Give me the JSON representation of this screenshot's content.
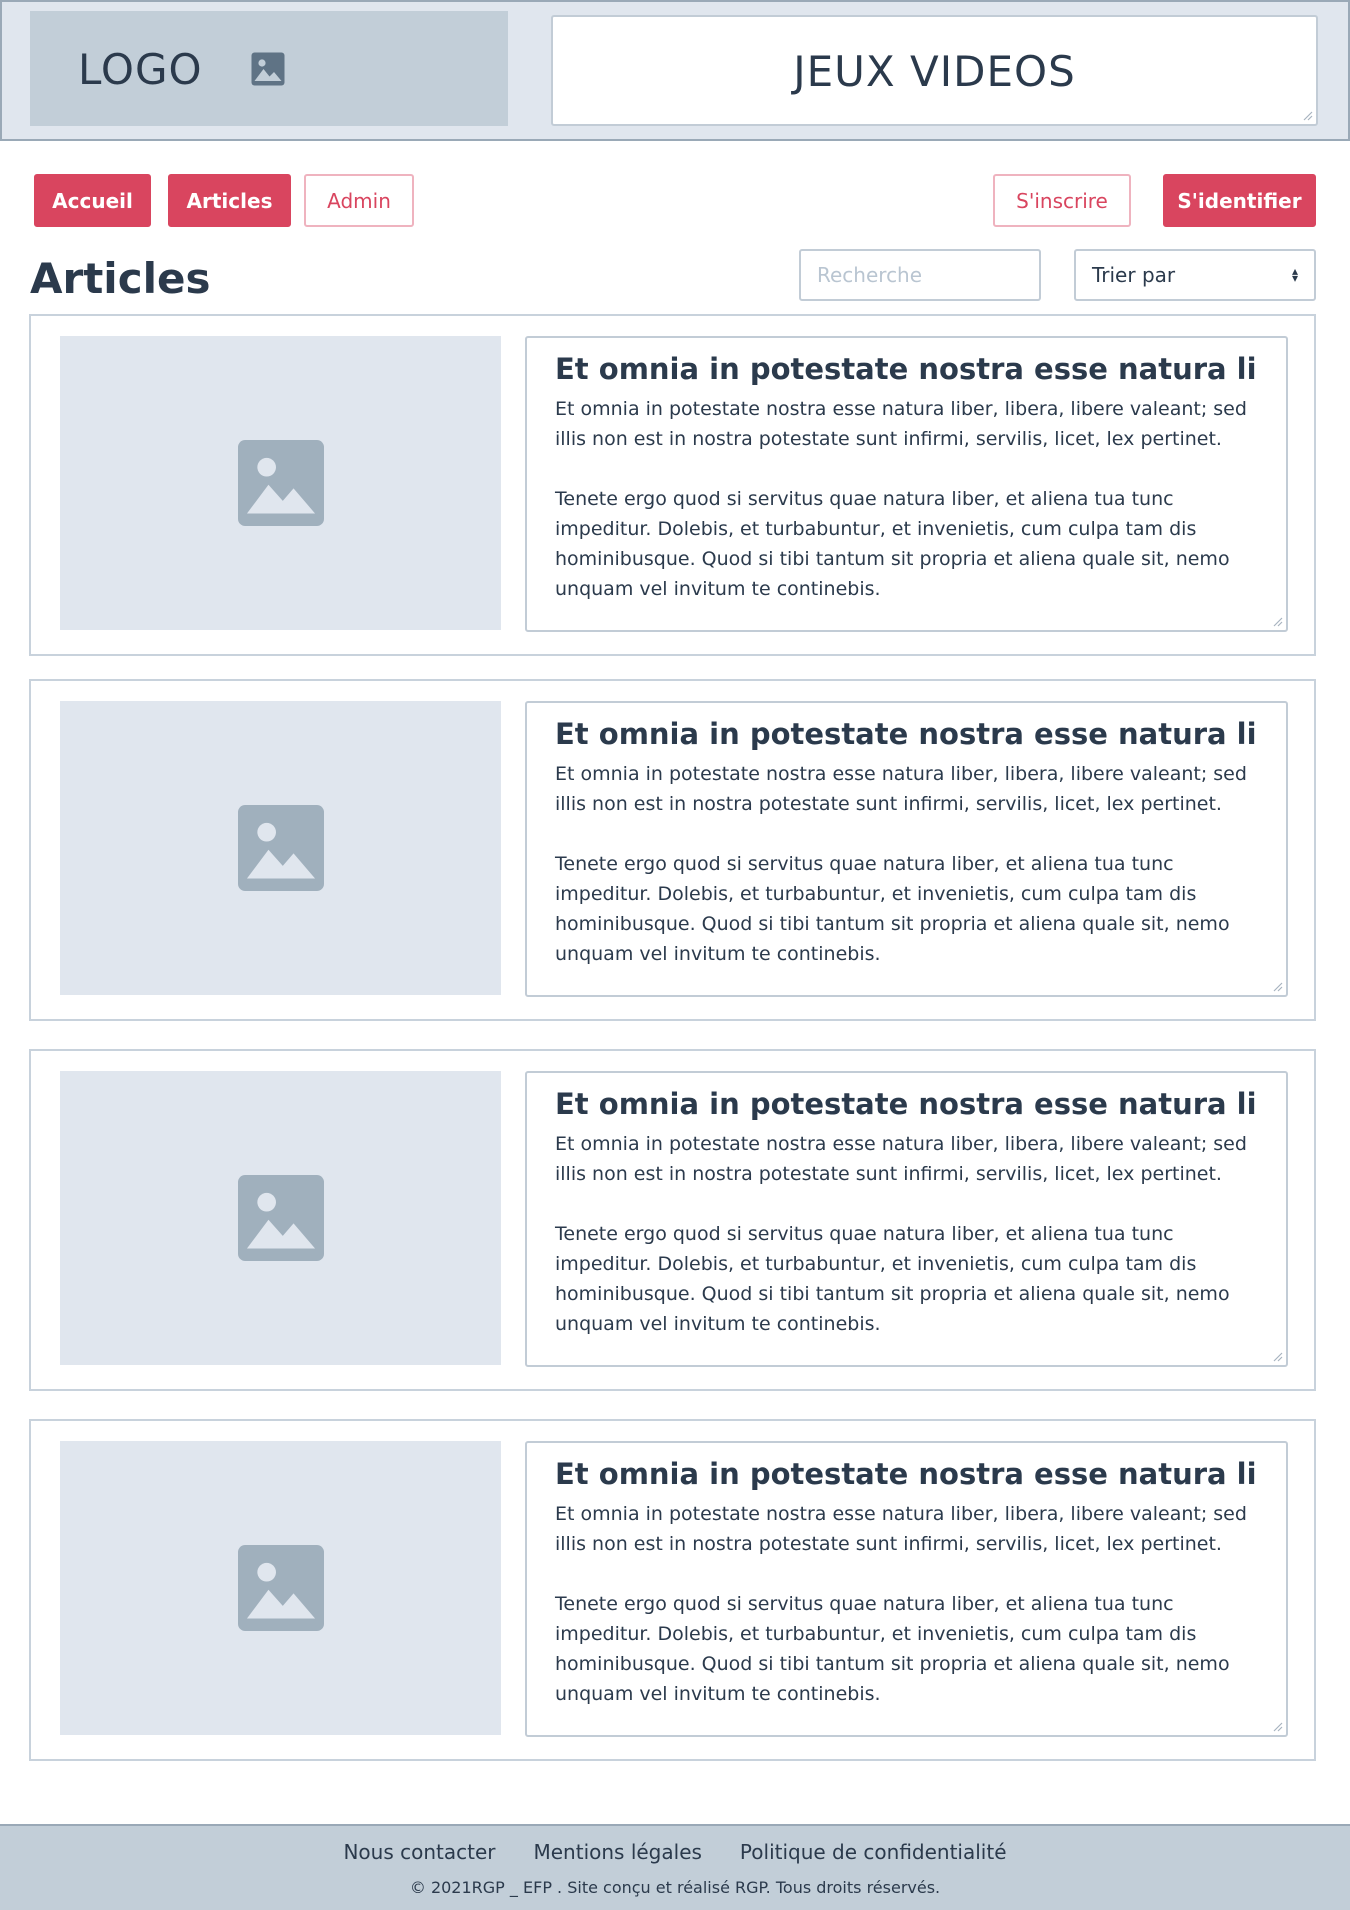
{
  "header": {
    "logo_label": "LOGO",
    "logo_icon": "image-icon",
    "site_title": "JEUX VIDEOS"
  },
  "nav": {
    "home": "Accueil",
    "articles": "Articles",
    "admin": "Admin",
    "signup": "S'inscrire",
    "login": "S'identifier"
  },
  "page": {
    "title": "Articles",
    "search_placeholder": "Recherche",
    "sort_label": "Trier par"
  },
  "articles": [
    {
      "title": "Et omnia in potestate nostra esse natura liber,",
      "p1": "Et omnia in potestate nostra esse natura liber, libera, libere valeant; sed illis non est in nostra potestate sunt infirmi, servilis, licet, lex pertinet.",
      "p2": "Tenete ergo quod si servitus quae natura liber, et aliena tua tunc impeditur. Dolebis, et turbabuntur, et invenietis, cum culpa tam dis hominibusque. Quod si tibi tantum sit propria et aliena quale sit, nemo unquam vel invitum te continebis."
    },
    {
      "title": "Et omnia in potestate nostra esse natura liber,",
      "p1": "Et omnia in potestate nostra esse natura liber, libera, libere valeant; sed illis non est in nostra potestate sunt infirmi, servilis, licet, lex pertinet.",
      "p2": "Tenete ergo quod si servitus quae natura liber, et aliena tua tunc impeditur. Dolebis, et turbabuntur, et invenietis, cum culpa tam dis hominibusque. Quod si tibi tantum sit propria et aliena quale sit, nemo unquam vel invitum te continebis."
    },
    {
      "title": "Et omnia in potestate nostra esse natura liber,",
      "p1": "Et omnia in potestate nostra esse natura liber, libera, libere valeant; sed illis non est in nostra potestate sunt infirmi, servilis, licet, lex pertinet.",
      "p2": "Tenete ergo quod si servitus quae natura liber, et aliena tua tunc impeditur. Dolebis, et turbabuntur, et invenietis, cum culpa tam dis hominibusque. Quod si tibi tantum sit propria et aliena quale sit, nemo unquam vel invitum te continebis."
    },
    {
      "title": "Et omnia in potestate nostra esse natura liber,",
      "p1": "Et omnia in potestate nostra esse natura liber, libera, libere valeant; sed illis non est in nostra potestate sunt infirmi, servilis, licet, lex pertinet.",
      "p2": "Tenete ergo quod si servitus quae natura liber, et aliena tua tunc impeditur. Dolebis, et turbabuntur, et invenietis, cum culpa tam dis hominibusque. Quod si tibi tantum sit propria et aliena quale sit, nemo unquam vel invitum te continebis."
    }
  ],
  "footer": {
    "contact": "Nous contacter",
    "legal": "Mentions légales",
    "privacy": "Politique de confidentialité",
    "copyright": "© 2021RGP _ EFP . Site conçu et réalisé  RGP. Tous droits réservés."
  },
  "colors": {
    "accent": "#d9455f",
    "header_bg": "#e0e6ee",
    "placeholder_bg": "#e0e6ee",
    "footer_bg": "#c2ced8",
    "text": "#2b3a4c"
  }
}
